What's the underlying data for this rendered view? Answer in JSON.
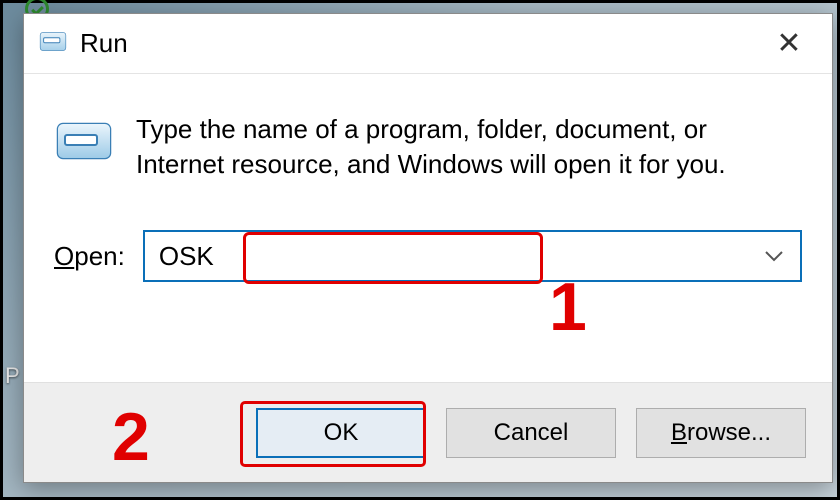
{
  "window": {
    "title": "Run",
    "close_glyph": "✕"
  },
  "instruction": "Type the name of a program, folder, document, or Internet resource, and Windows will open it for you.",
  "open": {
    "label_prefix_ul": "O",
    "label_rest": "pen:",
    "value": "OSK"
  },
  "buttons": {
    "ok": "OK",
    "cancel": "Cancel",
    "browse_ul": "B",
    "browse_rest": "rowse..."
  },
  "annotations": {
    "one": "1",
    "two": "2"
  },
  "icons": {
    "run": "run-icon",
    "chevron": "chevron-down-icon",
    "close": "close-icon"
  },
  "desktop_hint": "P"
}
